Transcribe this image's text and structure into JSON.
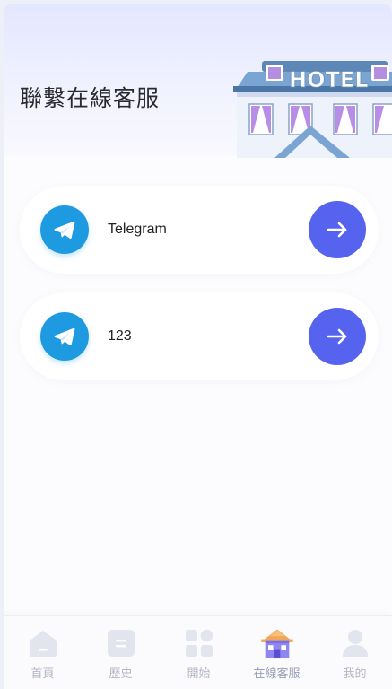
{
  "header": {
    "title": "聯繫在線客服",
    "illustration_text": "HOTEL"
  },
  "contacts": [
    {
      "label": "Telegram",
      "icon": "telegram-icon",
      "action_icon": "arrow-right-icon"
    },
    {
      "label": "123",
      "icon": "telegram-icon",
      "action_icon": "arrow-right-icon"
    }
  ],
  "tabbar": {
    "tabs": [
      {
        "label": "首頁",
        "icon": "home-icon"
      },
      {
        "label": "歷史",
        "icon": "history-icon"
      },
      {
        "label": "開始",
        "icon": "grid-icon"
      },
      {
        "label": "在線客服",
        "icon": "customer-service-icon",
        "active": true
      },
      {
        "label": "我的",
        "icon": "profile-icon"
      }
    ]
  },
  "colors": {
    "accent": "#5663ee",
    "telegram": "#1e9be0",
    "tab_inactive": "#b3b6c4"
  }
}
